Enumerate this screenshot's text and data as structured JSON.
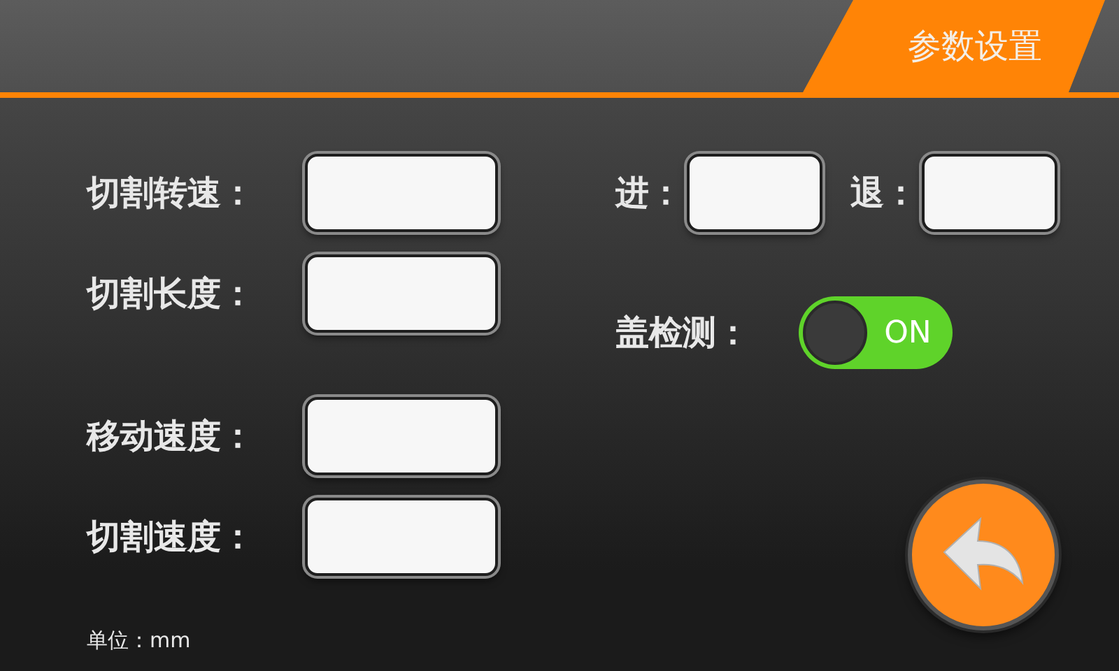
{
  "header": {
    "title": "参数设置"
  },
  "left_fields": [
    {
      "label": "切割转速："
    },
    {
      "label": "切割长度："
    },
    {
      "label": "移动速度："
    },
    {
      "label": "切割速度："
    }
  ],
  "right_fields": [
    {
      "label": "进："
    },
    {
      "label": "退："
    }
  ],
  "cover_detection": {
    "label": "盖检测：",
    "on": true,
    "text": "ON"
  },
  "unit": "单位：mm"
}
